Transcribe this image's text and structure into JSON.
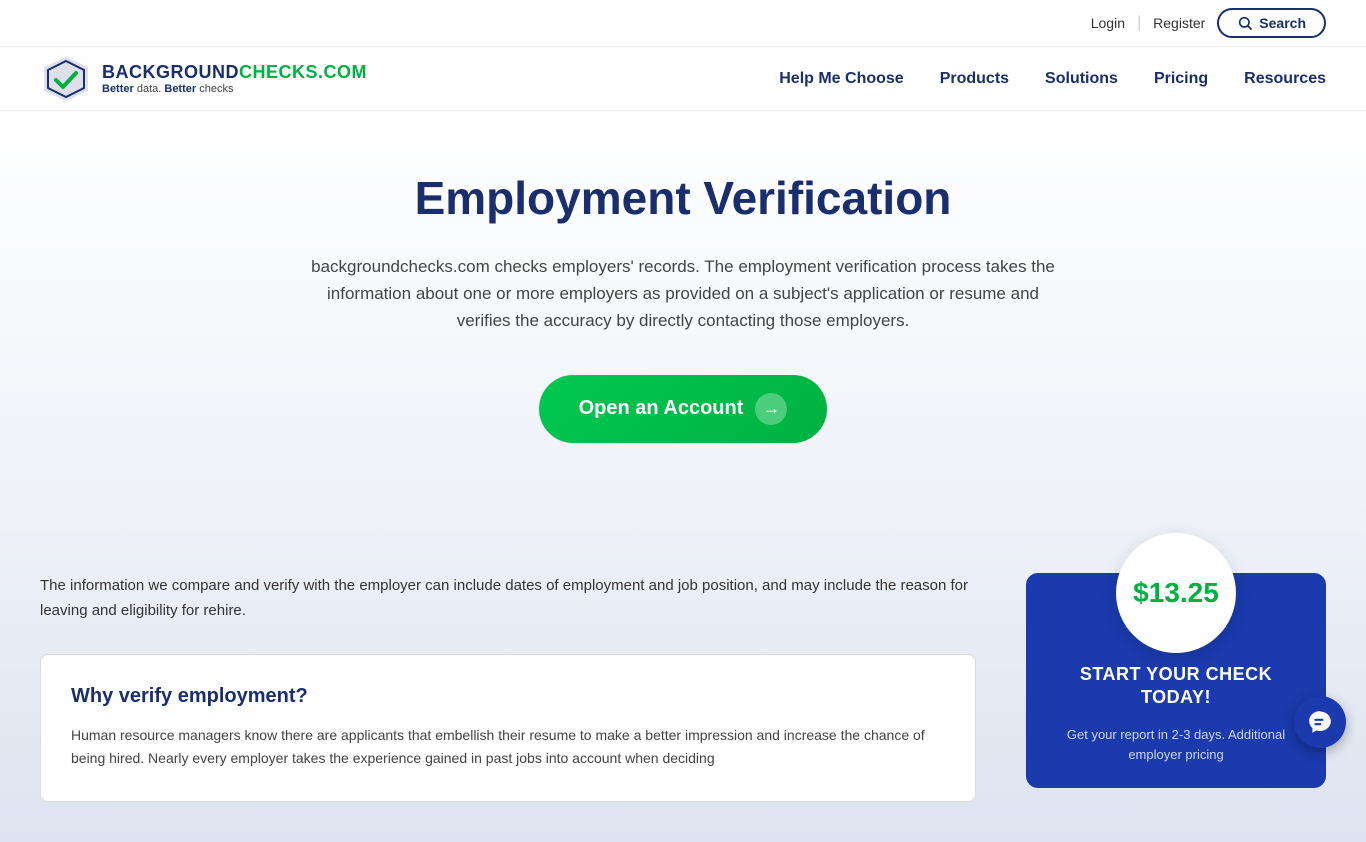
{
  "topbar": {
    "login_label": "Login",
    "register_label": "Register",
    "search_label": "Search"
  },
  "nav": {
    "logo_title_blue": "BACKGROUND",
    "logo_title_green": "CHECKS.COM",
    "logo_subtitle_better": "Better",
    "logo_subtitle_data": " data. ",
    "logo_subtitle_better2": "Better",
    "logo_subtitle_checks": " checks",
    "links": [
      {
        "label": "Help Me Choose"
      },
      {
        "label": "Products"
      },
      {
        "label": "Solutions"
      },
      {
        "label": "Pricing"
      },
      {
        "label": "Resources"
      }
    ]
  },
  "hero": {
    "title": "Employment Verification",
    "description": "backgroundchecks.com checks employers' records. The employment verification process takes the information about one or more employers as provided on a subject's application or resume and verifies the accuracy by directly contacting those employers.",
    "cta_label": "Open an Account"
  },
  "lower": {
    "info_text": "The information we compare and verify with the employer can include dates of employment and job position, and may include the reason for leaving and eligibility for rehire.",
    "why_box": {
      "heading": "Why verify employment?",
      "text": "Human resource managers know there are applicants that embellish their resume to make a better impression and increase the chance of being hired. Nearly every employer takes the experience gained in past jobs into account when deciding"
    }
  },
  "price_card": {
    "amount": "$13.25",
    "cta": "START YOUR CHECK TODAY!",
    "subtitle": "Get your report in 2-3 days. Additional employer pricing"
  }
}
